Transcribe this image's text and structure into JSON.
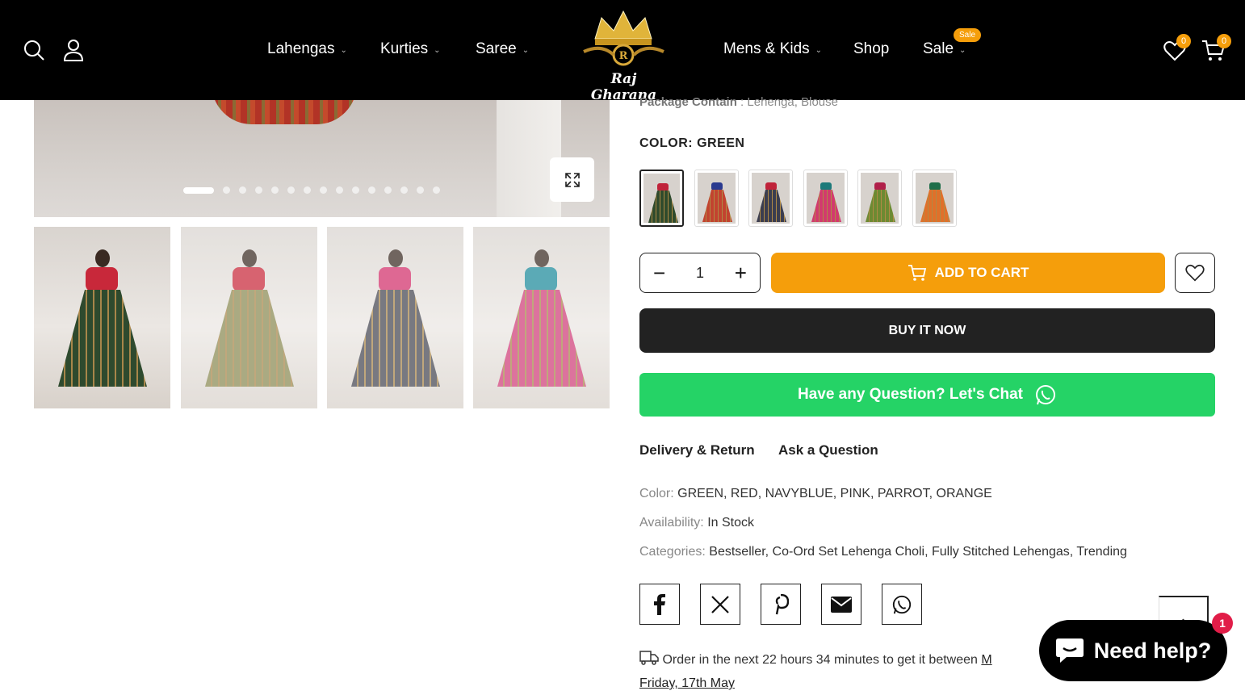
{
  "header": {
    "nav": [
      {
        "label": "Lahengas"
      },
      {
        "label": "Kurties"
      },
      {
        "label": "Saree"
      },
      {
        "label": "Mens & Kids"
      },
      {
        "label": "Shop"
      },
      {
        "label": "Sale"
      }
    ],
    "sale_badge": "Sale",
    "logo_text": "Raj Gharana",
    "wishlist_count": "0",
    "cart_count": "0"
  },
  "product": {
    "package_label": "Package Contain",
    "package_value": ": Lehenga, Blouse",
    "color_label": "COLOR:",
    "color_selected": "GREEN",
    "swatches": [
      {
        "name": "GREEN",
        "top": "#c0233a",
        "skirt": "#2f4a2c"
      },
      {
        "name": "RED",
        "top": "#2a3a8f",
        "skirt": "#c2432f"
      },
      {
        "name": "NAVYBLUE",
        "top": "#c0233a",
        "skirt": "#3b3d4f"
      },
      {
        "name": "PINK",
        "top": "#1c7a7a",
        "skirt": "#d23a6e"
      },
      {
        "name": "PARROT",
        "top": "#b0204a",
        "skirt": "#6d8a32"
      },
      {
        "name": "ORANGE",
        "top": "#1e6e4a",
        "skirt": "#e0702a"
      }
    ],
    "quantity": "1",
    "add_to_cart": "ADD TO CART",
    "buy_now": "BUY IT NOW",
    "chat": "Have any Question? Let's Chat",
    "tabs": {
      "delivery": "Delivery & Return",
      "ask": "Ask a Question"
    },
    "meta": {
      "color_label": "Color:",
      "color_value": "GREEN, RED, NAVYBLUE, PINK, PARROT, ORANGE",
      "availability_label": "Availability:",
      "availability_value": "In Stock",
      "categories_label": "Categories:",
      "categories_value": "Bestseller, Co-Ord Set Lehenga Choli, Fully Stitched Lehengas, Trending"
    },
    "delivery_text": "Order in the next 22 hours 34 minutes to get it between",
    "delivery_date_start": "M",
    "delivery_date_end": "Friday, 17th May"
  },
  "gallery": {
    "thumbs": [
      {
        "top": "#c8283a",
        "skirt": "#2e4a2e"
      },
      {
        "top": "#c8283a",
        "skirt": "#8a8a52"
      },
      {
        "top": "#d22f6a",
        "skirt": "#454651"
      },
      {
        "top": "#1c8a9a",
        "skirt": "#cf3e78"
      }
    ],
    "dots": 15
  },
  "chat_widget": {
    "label": "Need help?",
    "badge": "1"
  },
  "colors": {
    "accent": "#f59e0b",
    "whatsapp": "#25d366",
    "dark": "#222222"
  }
}
